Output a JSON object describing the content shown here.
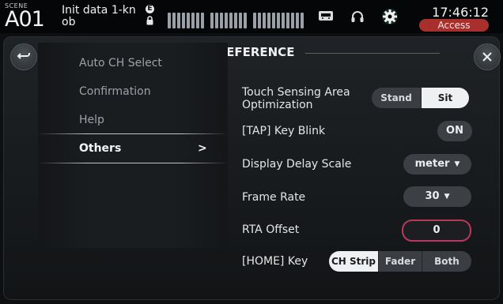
{
  "status_bar": {
    "scene_label": "SCENE",
    "scene_number": "A01",
    "scene_name": "Init data 1-kn ob",
    "edit_badge": "E",
    "time": "17:46:12",
    "access_label": "Access"
  },
  "icons": [
    "back-icon",
    "close-icon",
    "lock-icon",
    "recorder-icon",
    "headphones-icon",
    "gear-icon"
  ],
  "dialog": {
    "title": "PREFERENCE"
  },
  "menu": {
    "items": [
      {
        "label": "Auto CH Select"
      },
      {
        "label": "Confirmation"
      },
      {
        "label": "Help"
      },
      {
        "label": "Others"
      }
    ],
    "active_arrow": ">"
  },
  "settings": {
    "touch_sensing": {
      "label": "Touch Sensing Area Optimization",
      "options": [
        "Stand",
        "Sit"
      ],
      "selected": "Sit"
    },
    "tap_key_blink": {
      "label": "[TAP] Key Blink",
      "value": "ON"
    },
    "display_delay_scale": {
      "label": "Display Delay Scale",
      "value": "meter"
    },
    "frame_rate": {
      "label": "Frame Rate",
      "value": "30"
    },
    "rta_offset": {
      "label": "RTA Offset",
      "value": "0"
    },
    "home_key": {
      "label": "[HOME] Key",
      "options": [
        "CH Strip",
        "Fader",
        "Both"
      ],
      "selected": "CH Strip"
    }
  },
  "colors": {
    "access_bg": "#a8302c",
    "rta_border": "#b73a5c",
    "selected_segment": "#eef0f2"
  }
}
